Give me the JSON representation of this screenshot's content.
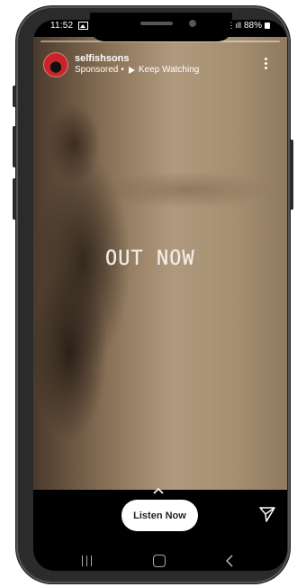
{
  "status_bar": {
    "time": "11:52",
    "battery": "88%"
  },
  "story": {
    "progress": 0.0
  },
  "header": {
    "account_name": "selfishsons",
    "sponsored_label": "Sponsored",
    "separator": "•",
    "keep_watching_label": "Keep Watching"
  },
  "content": {
    "overlay_text": "OUT NOW"
  },
  "footer": {
    "cta_label": "Listen Now"
  },
  "icons": {
    "gallery": "image-icon",
    "more": "more-vertical-icon",
    "play": "play-icon",
    "swipe_up": "chevron-up-icon",
    "send": "send-icon",
    "nav_recent": "recent-apps-icon",
    "nav_home": "home-icon",
    "nav_back": "back-icon"
  }
}
